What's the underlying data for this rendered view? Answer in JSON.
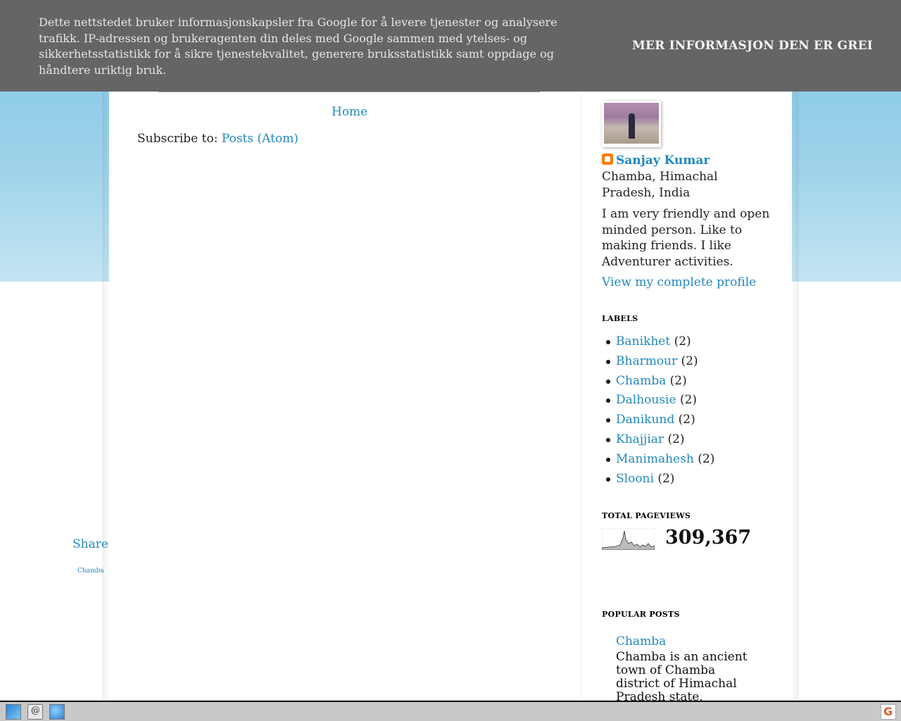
{
  "cookie_banner": {
    "text": "Dette nettstedet bruker informasjonskapsler fra Google for å levere tjenester og analysere trafikk. IP-adressen og brukeragenten din deles med Google sammen med ytelses- og sikkerhetsstatistikk for å sikre tjenestekvalitet, generere bruksstatistikk samt oppdage og håndtere uriktig bruk.",
    "more_info_label": "MER INFORMASJON",
    "ok_label": "DEN ER GREI"
  },
  "main": {
    "home_link": "Home",
    "subscribe_prefix": "Subscribe to:",
    "subscribe_link": "Posts (Atom)"
  },
  "share": {
    "label": "Share",
    "tag": "Chamba"
  },
  "profile": {
    "name": "Sanjay Kumar",
    "location": "Chamba, Himachal Pradesh, India",
    "about": "I am very friendly and open minded person. Like to making friends. I like Adventurer activities.",
    "view_profile": "View my complete profile"
  },
  "labels": {
    "title": "LABELS",
    "items": [
      {
        "name": "Banikhet",
        "count": "(2)"
      },
      {
        "name": "Bharmour",
        "count": "(2)"
      },
      {
        "name": "Chamba",
        "count": "(2)"
      },
      {
        "name": "Dalhousie",
        "count": "(2)"
      },
      {
        "name": "Danikund",
        "count": "(2)"
      },
      {
        "name": "Khajjiar",
        "count": "(2)"
      },
      {
        "name": "Manimahesh",
        "count": "(2)"
      },
      {
        "name": "Slooni",
        "count": "(2)"
      }
    ]
  },
  "pageviews": {
    "title": "TOTAL PAGEVIEWS",
    "count": "309,367"
  },
  "popular_posts": {
    "title": "POPULAR POSTS",
    "first_title": "Chamba",
    "first_snippet": "Chamba is an ancient town of Chamba district of Himachal Pradesh state, northern India."
  },
  "taskbar": {
    "icons": [
      "chart-icon",
      "mail-icon",
      "globe-icon",
      "google-icon"
    ]
  },
  "colors": {
    "link": "#2288bb",
    "cookie_bg": "#656565",
    "sky": "#7cc5e3"
  }
}
